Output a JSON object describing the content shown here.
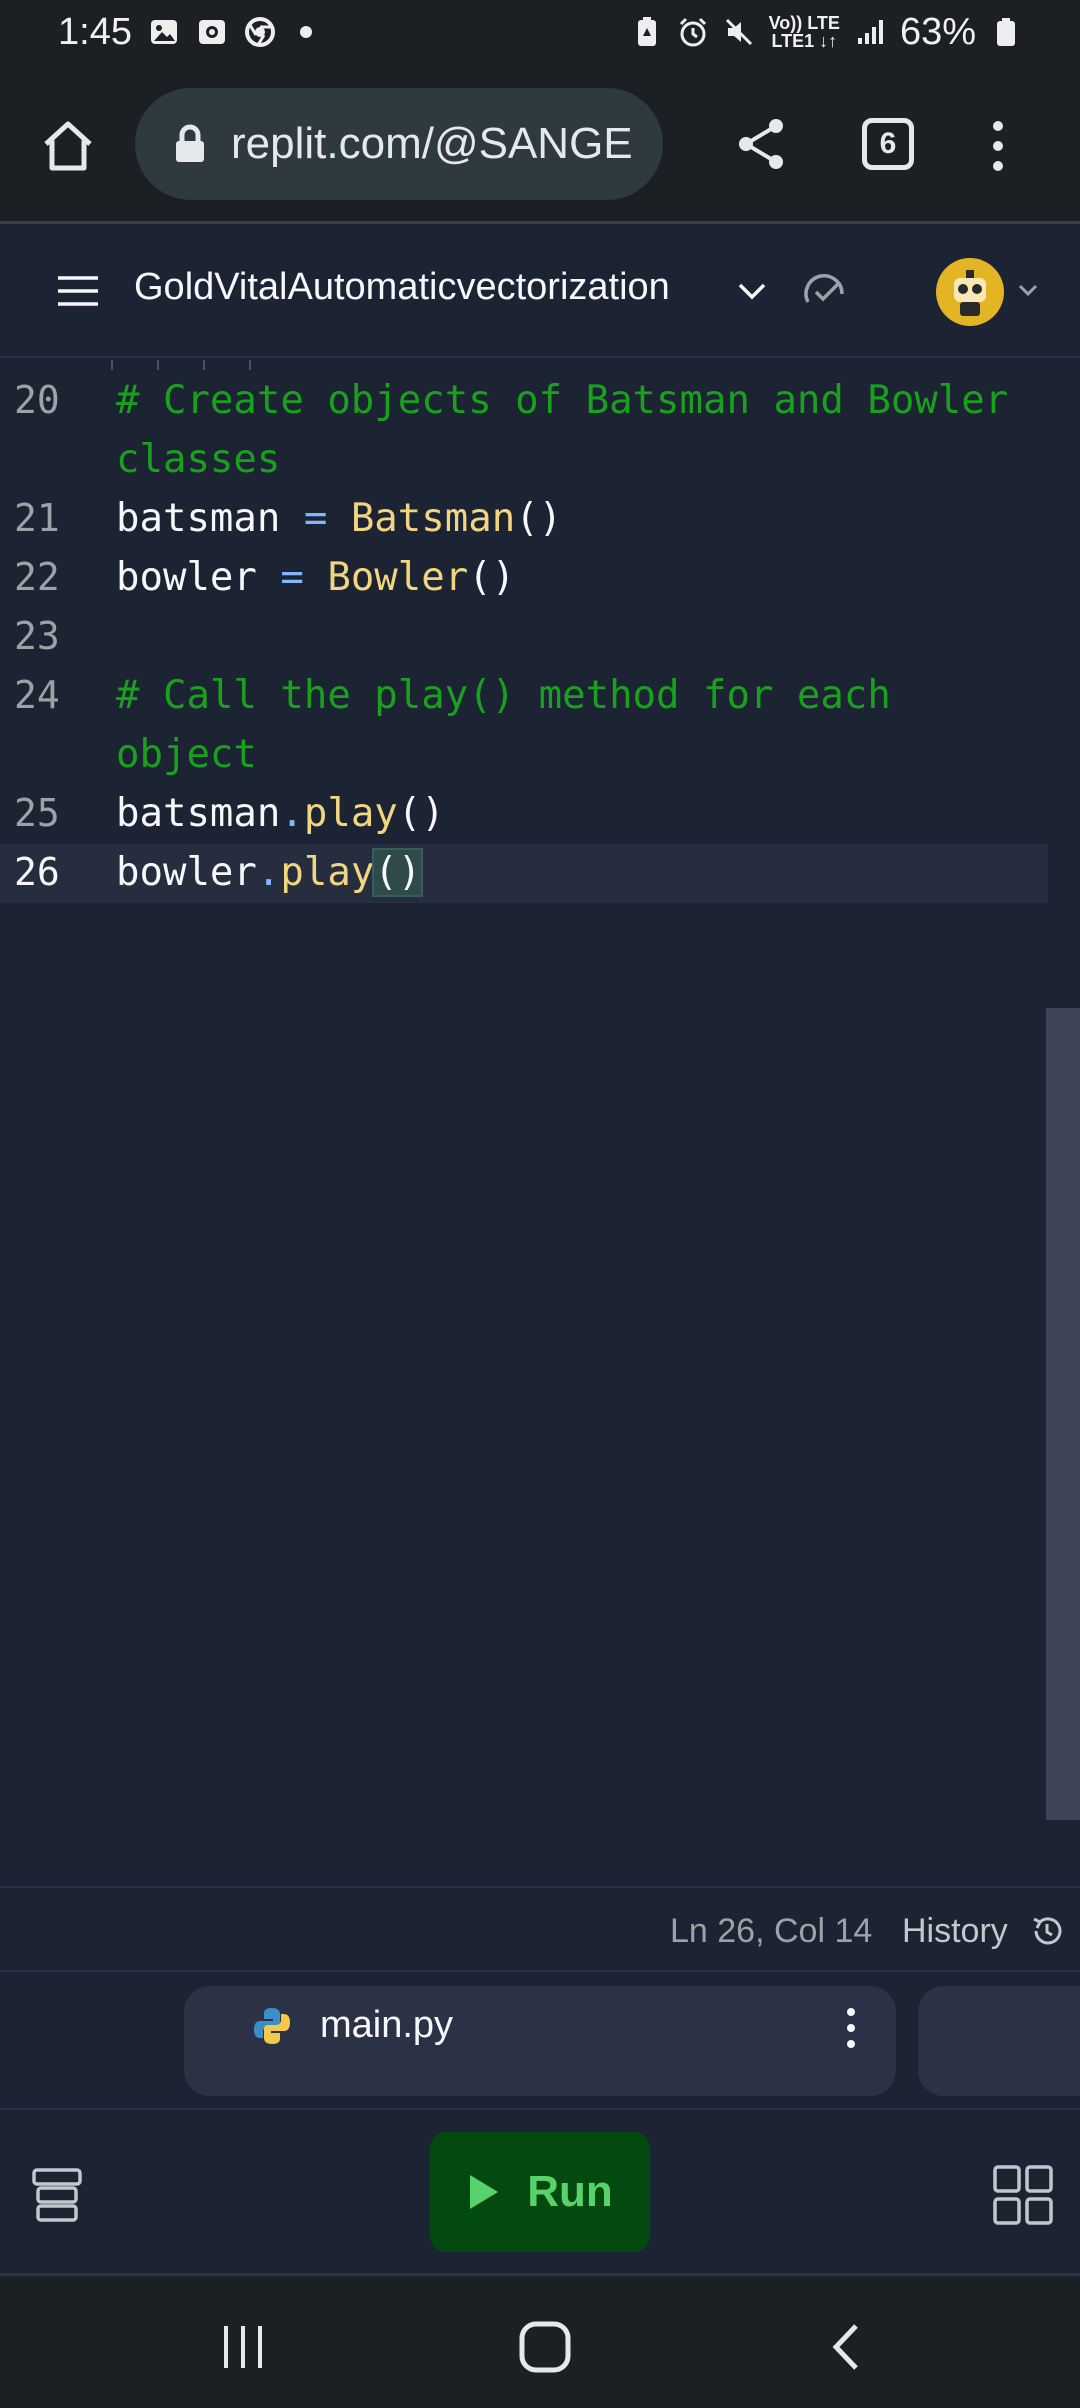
{
  "status_bar": {
    "time": "1:45",
    "network_top": "Vo)) LTE",
    "network_bottom": "LTE1 ↓↑",
    "battery": "63%"
  },
  "browser": {
    "url": "replit.com/@SANGE",
    "tab_count": "6"
  },
  "header": {
    "repl_name": "GoldVitalAutomaticvectorization"
  },
  "editor": {
    "lines": [
      {
        "num": "20",
        "text": "# Create objects of Batsman and Bowler",
        "cont": "classes"
      },
      {
        "num": "21",
        "var": "batsman",
        "eq": " = ",
        "call": "Batsman",
        "args": "()"
      },
      {
        "num": "22",
        "var": "bowler",
        "eq": " = ",
        "call": "Bowler",
        "args": "()"
      },
      {
        "num": "23"
      },
      {
        "num": "24",
        "text": "# Call the play() method for each",
        "cont": "object"
      },
      {
        "num": "25",
        "var": "batsman",
        "dot": ".",
        "call": "play",
        "args": "()"
      },
      {
        "num": "26",
        "var": "bowler",
        "dot": ".",
        "call": "play",
        "args": "()"
      }
    ]
  },
  "editor_status": {
    "cursor": "Ln 26, Col 14",
    "history_label": "History"
  },
  "file_tab": {
    "name": "main.py"
  },
  "actions": {
    "run_label": "Run"
  },
  "colors": {
    "background": "#1c2333",
    "comment": "#19a11e",
    "function": "#f2d57f",
    "operator": "#82b7ff",
    "run_button": "#044a10",
    "run_text": "#58d26b"
  }
}
